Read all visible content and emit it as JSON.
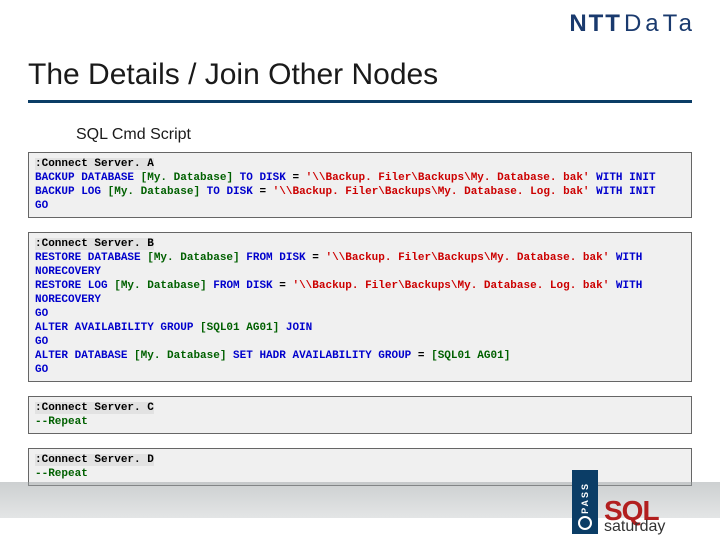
{
  "brand": {
    "main": "NTT",
    "sub": "DaTa"
  },
  "title": "The Details / Join Other Nodes",
  "subtitle": "SQL Cmd Script",
  "code_blocks": [
    {
      "connect": ":Connect Server. A",
      "lines": [
        {
          "type": "sql",
          "tokens": [
            {
              "t": "kw",
              "v": "BACKUP DATABASE "
            },
            {
              "t": "id",
              "v": "[My. Database]"
            },
            {
              "t": "kw",
              "v": " TO DISK "
            },
            {
              "t": "plain",
              "v": "= "
            },
            {
              "t": "str",
              "v": "'\\\\Backup. Filer\\Backups\\My. Database. bak'"
            },
            {
              "t": "kw",
              "v": " WITH INIT"
            }
          ]
        },
        {
          "type": "sql",
          "tokens": [
            {
              "t": "kw",
              "v": "BACKUP LOG "
            },
            {
              "t": "id",
              "v": "[My. Database]"
            },
            {
              "t": "kw",
              "v": " TO DISK "
            },
            {
              "t": "plain",
              "v": "= "
            },
            {
              "t": "str",
              "v": "'\\\\Backup. Filer\\Backups\\My. Database. Log. bak'"
            },
            {
              "t": "kw",
              "v": " WITH INIT"
            }
          ]
        },
        {
          "type": "sql",
          "tokens": [
            {
              "t": "kw",
              "v": "GO"
            }
          ]
        }
      ]
    },
    {
      "connect": ":Connect Server. B",
      "lines": [
        {
          "type": "sql",
          "tokens": [
            {
              "t": "kw",
              "v": "RESTORE DATABASE "
            },
            {
              "t": "id",
              "v": "[My. Database]"
            },
            {
              "t": "kw",
              "v": " FROM DISK "
            },
            {
              "t": "plain",
              "v": "= "
            },
            {
              "t": "str",
              "v": "'\\\\Backup. Filer\\Backups\\My. Database. bak'"
            },
            {
              "t": "kw",
              "v": " WITH NORECOVERY"
            }
          ]
        },
        {
          "type": "sql",
          "tokens": [
            {
              "t": "kw",
              "v": "RESTORE LOG "
            },
            {
              "t": "id",
              "v": "[My. Database]"
            },
            {
              "t": "kw",
              "v": " FROM DISK "
            },
            {
              "t": "plain",
              "v": "= "
            },
            {
              "t": "str",
              "v": "'\\\\Backup. Filer\\Backups\\My. Database. Log. bak'"
            },
            {
              "t": "kw",
              "v": " WITH NORECOVERY"
            }
          ]
        },
        {
          "type": "sql",
          "tokens": [
            {
              "t": "kw",
              "v": "GO"
            }
          ]
        },
        {
          "type": "sql",
          "tokens": [
            {
              "t": "kw",
              "v": "ALTER AVAILABILITY GROUP "
            },
            {
              "t": "id",
              "v": "[SQL01 AG01]"
            },
            {
              "t": "kw",
              "v": " JOIN"
            }
          ]
        },
        {
          "type": "sql",
          "tokens": [
            {
              "t": "kw",
              "v": "GO"
            }
          ]
        },
        {
          "type": "sql",
          "tokens": [
            {
              "t": "kw",
              "v": "ALTER DATABASE "
            },
            {
              "t": "id",
              "v": "[My. Database]"
            },
            {
              "t": "kw",
              "v": " SET HADR AVAILABILITY GROUP "
            },
            {
              "t": "plain",
              "v": "= "
            },
            {
              "t": "id",
              "v": "[SQL01 AG01]"
            }
          ]
        },
        {
          "type": "sql",
          "tokens": [
            {
              "t": "kw",
              "v": "GO"
            }
          ]
        }
      ]
    },
    {
      "connect": ":Connect Server. C",
      "lines": [
        {
          "type": "sql",
          "tokens": [
            {
              "t": "cmt",
              "v": "--Repeat"
            }
          ]
        }
      ]
    },
    {
      "connect": ":Connect Server. D",
      "lines": [
        {
          "type": "sql",
          "tokens": [
            {
              "t": "cmt",
              "v": "--Repeat"
            }
          ]
        }
      ]
    }
  ],
  "footer_logo": {
    "badge": "PASS",
    "top": "SQL",
    "bottom": "saturday"
  }
}
